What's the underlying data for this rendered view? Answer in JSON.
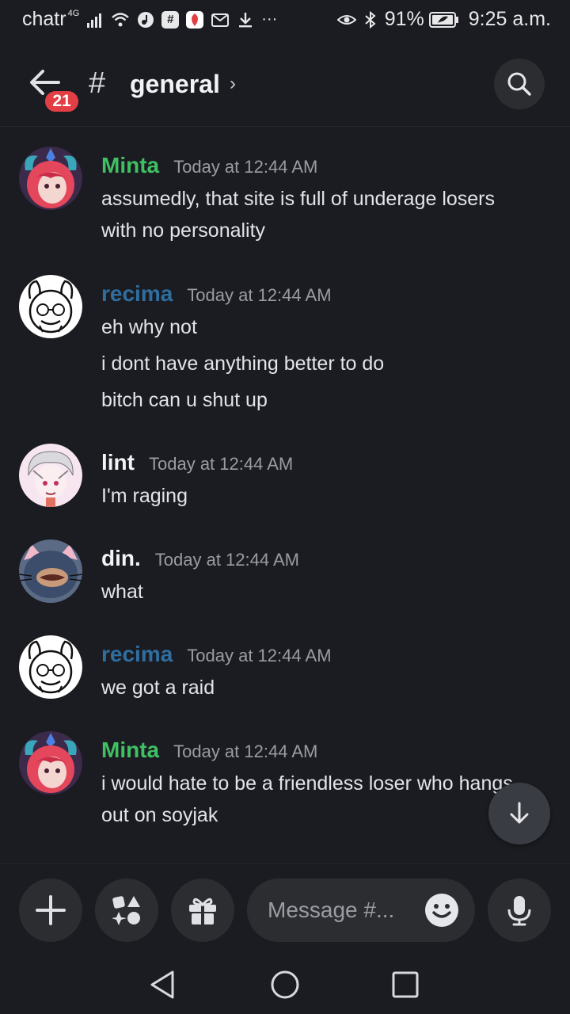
{
  "status_bar": {
    "carrier": "chatr",
    "network": "4G",
    "battery": "91%",
    "time": "9:25 a.m."
  },
  "header": {
    "unread_count": "21",
    "channel_hash": "#",
    "channel_name": "general",
    "chevron": "›"
  },
  "messages": [
    {
      "author": "Minta",
      "author_color": "#3fc163",
      "timestamp": "Today at 12:44 AM",
      "avatar": "minta-avatar",
      "lines": [
        "assumedly, that site is full of underage losers",
        "with no personality"
      ]
    },
    {
      "author": "recima",
      "author_color": "#2f6ea0",
      "timestamp": "Today at 12:44 AM",
      "avatar": "recima-avatar",
      "lines": [
        "eh why not",
        "i dont have anything better to do",
        "bitch can u shut up"
      ]
    },
    {
      "author": "lint",
      "author_color": "#f2f3f5",
      "timestamp": "Today at 12:44 AM",
      "avatar": "lint-avatar",
      "lines": [
        "I'm raging"
      ]
    },
    {
      "author": "din.",
      "author_color": "#f2f3f5",
      "timestamp": "Today at 12:44 AM",
      "avatar": "din-avatar",
      "lines": [
        "what"
      ]
    },
    {
      "author": "recima",
      "author_color": "#2f6ea0",
      "timestamp": "Today at 12:44 AM",
      "avatar": "recima-avatar",
      "lines": [
        "we got a raid"
      ]
    },
    {
      "author": "Minta",
      "author_color": "#3fc163",
      "timestamp": "Today at 12:44 AM",
      "avatar": "minta-avatar",
      "lines": [
        "i would hate to be a friendless loser who hangs",
        "out on soyjak"
      ]
    }
  ],
  "composer": {
    "placeholder": "Message #...",
    "icons": [
      "plus-icon",
      "apps-icon",
      "gift-icon",
      "emoji-icon",
      "microphone-icon"
    ]
  },
  "nav": {
    "icons": [
      "back-triangle-icon",
      "home-circle-icon",
      "recents-square-icon"
    ]
  },
  "colors": {
    "background": "#1b1c21",
    "surface": "#2b2d31",
    "badge": "#e13f45"
  }
}
